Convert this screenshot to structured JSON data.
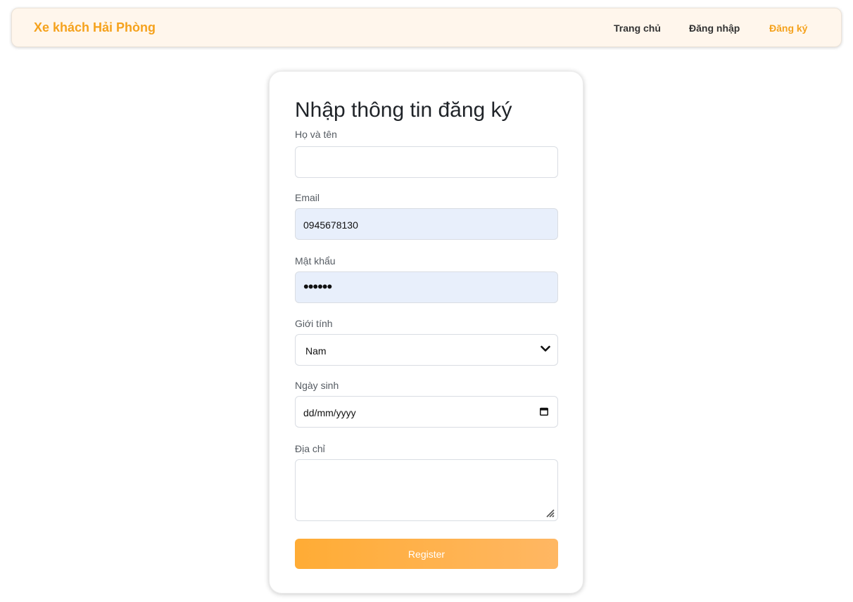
{
  "header": {
    "brand": "Xe khách Hải Phòng",
    "nav": {
      "home": "Trang chủ",
      "login": "Đăng nhập",
      "register": "Đăng ký"
    },
    "active_color": "#f5a21d",
    "background": "#fff6ec"
  },
  "form": {
    "title": "Nhập thông tin đăng ký",
    "fields": {
      "fullname": {
        "label": "Họ và tên",
        "value": ""
      },
      "email": {
        "label": "Email",
        "value": "0945678130"
      },
      "password": {
        "label": "Mật khẩu",
        "value": "••••••"
      },
      "gender": {
        "label": "Giới tính",
        "value": "Nam"
      },
      "birthday": {
        "label": "Ngày sinh",
        "value": "dd/mm/yyyy"
      },
      "address": {
        "label": "Địa chỉ",
        "value": ""
      }
    },
    "submit": "Register",
    "submit_gradient": [
      "#ffac35",
      "#ffb763"
    ],
    "autofill_color": "#e8effb"
  }
}
